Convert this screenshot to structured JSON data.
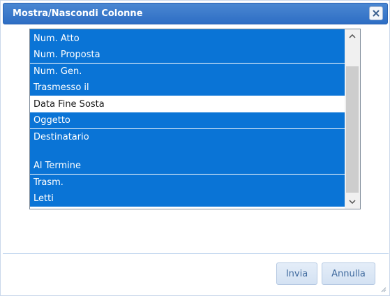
{
  "dialog": {
    "title": "Mostra/Nascondi Colonne",
    "close_icon": "close-x-icon"
  },
  "columns": [
    {
      "label": "Num. Atto",
      "selected": true
    },
    {
      "label": "Num. Proposta",
      "selected": true
    },
    {
      "label": "Num. Gen.",
      "selected": true
    },
    {
      "label": "Trasmesso il",
      "selected": true
    },
    {
      "label": "Data Fine Sosta",
      "selected": false
    },
    {
      "label": "Oggetto",
      "selected": true
    },
    {
      "label": "Destinatario",
      "selected": true
    },
    {
      "label": "",
      "selected": true
    },
    {
      "label": "Al Termine",
      "selected": true
    },
    {
      "label": "Trasm.",
      "selected": true
    },
    {
      "label": "Letti",
      "selected": true
    }
  ],
  "buttons": {
    "send_label": "Invia",
    "cancel_label": "Annulla"
  },
  "colors": {
    "selected_bg": "#0a74d6",
    "title_bg": "#2e6ec4",
    "button_text": "#3f6a9e"
  }
}
